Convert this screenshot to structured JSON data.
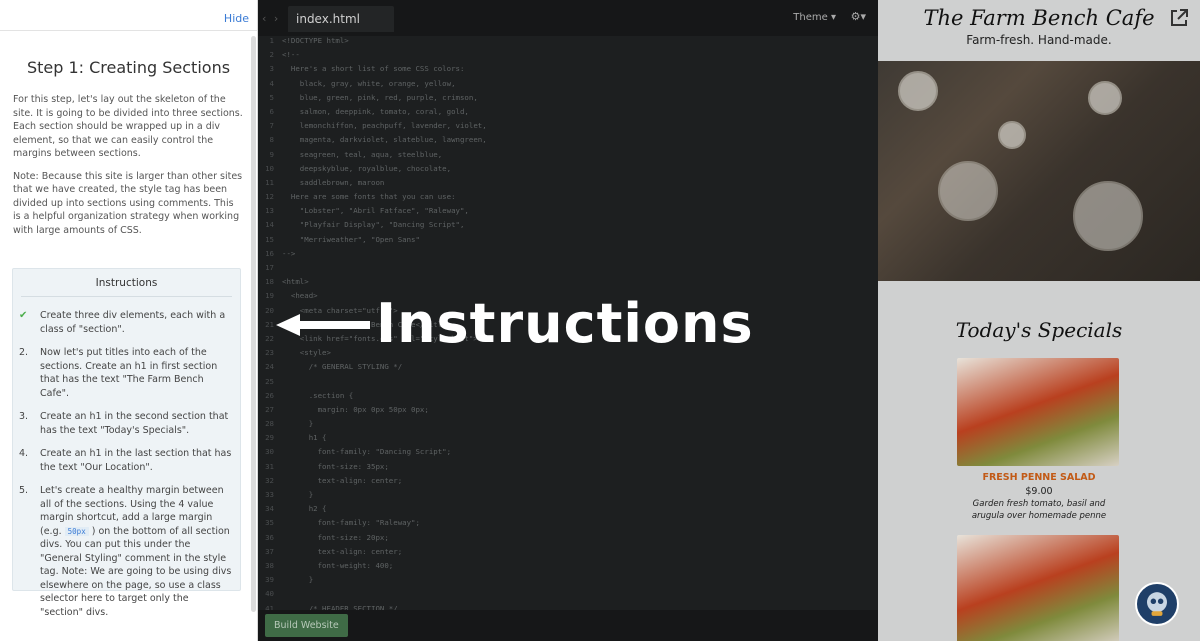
{
  "left_panel": {
    "hide_label": "Hide",
    "step_title": "Step 1: Creating Sections",
    "intro": "For this step, let's lay out the skeleton of the site. It is going to be divided into three sections. Each section should be wrapped up in a div element, so that we can easily control the margins between sections.",
    "note": "Note: Because this site is larger than other sites that we have created, the style tag has been divided up into sections using comments. This is a helpful organization strategy when working with large amounts of CSS.",
    "instructions_heading": "Instructions",
    "instructions": [
      {
        "marker": "✔",
        "text": "Create three div elements, each with a class of \"section\"."
      },
      {
        "marker": "2.",
        "text": "Now let's put titles into each of the sections. Create an h1 in first section that has the text \"The Farm Bench Cafe\"."
      },
      {
        "marker": "3.",
        "text": "Create an h1 in the second section that has the text \"Today's Specials\"."
      },
      {
        "marker": "4.",
        "text": "Create an h1 in the last section that has the text \"Our Location\"."
      },
      {
        "marker": "5.",
        "text_before": "Let's create a healthy margin between all of the sections. Using the 4 value margin shortcut, add a large margin (e.g.",
        "code": "50px",
        "text_after": ") on the bottom of all section divs. You can put this under the \"General Styling\" comment in the style tag. Note: We are going to be using divs elsewhere on the page, so use a class selector here to target only the \"section\" divs."
      }
    ]
  },
  "editor": {
    "tab_name": "index.html",
    "theme_label": "Theme ▾",
    "gear_label": "⚙▾",
    "build_button": "Build Website",
    "lines": [
      {
        "n": "1",
        "t": "<!DOCTYPE html>"
      },
      {
        "n": "2",
        "t": "<!--"
      },
      {
        "n": "3",
        "t": "  Here's a short list of some CSS colors:"
      },
      {
        "n": "4",
        "t": "    black, gray, white, orange, yellow,"
      },
      {
        "n": "5",
        "t": "    blue, green, pink, red, purple, crimson,"
      },
      {
        "n": "6",
        "t": "    salmon, deeppink, tomato, coral, gold,"
      },
      {
        "n": "7",
        "t": "    lemonchiffon, peachpuff, lavender, violet,"
      },
      {
        "n": "8",
        "t": "    magenta, darkviolet, slateblue, lawngreen,"
      },
      {
        "n": "9",
        "t": "    seagreen, teal, aqua, steelblue,"
      },
      {
        "n": "10",
        "t": "    deepskyblue, royalblue, chocolate,"
      },
      {
        "n": "11",
        "t": "    saddlebrown, maroon"
      },
      {
        "n": "12",
        "t": "  Here are some fonts that you can use:"
      },
      {
        "n": "13",
        "t": "    \"Lobster\", \"Abril Fatface\", \"Raleway\","
      },
      {
        "n": "14",
        "t": "    \"Playfair Display\", \"Dancing Script\","
      },
      {
        "n": "15",
        "t": "    \"Merriweather\", \"Open Sans\""
      },
      {
        "n": "16",
        "t": "-->"
      },
      {
        "n": "17",
        "t": ""
      },
      {
        "n": "18",
        "t": "<html>"
      },
      {
        "n": "19",
        "t": "  <head>"
      },
      {
        "n": "20",
        "t": "    <meta charset=\"utf-8\">"
      },
      {
        "n": "21",
        "t": "    <title>The Farm Bench Cafe</title>"
      },
      {
        "n": "22",
        "t": "    <link href=\"fonts.css\" rel=\"stylesheet\">"
      },
      {
        "n": "23",
        "t": "    <style>"
      },
      {
        "n": "24",
        "t": "      /* GENERAL STYLING */"
      },
      {
        "n": "25",
        "t": ""
      },
      {
        "n": "26",
        "t": "      .section {"
      },
      {
        "n": "27",
        "t": "        margin: 0px 0px 50px 0px;"
      },
      {
        "n": "28",
        "t": "      }"
      },
      {
        "n": "29",
        "t": "      h1 {"
      },
      {
        "n": "30",
        "t": "        font-family: \"Dancing Script\";"
      },
      {
        "n": "31",
        "t": "        font-size: 35px;"
      },
      {
        "n": "32",
        "t": "        text-align: center;"
      },
      {
        "n": "33",
        "t": "      }"
      },
      {
        "n": "34",
        "t": "      h2 {"
      },
      {
        "n": "35",
        "t": "        font-family: \"Raleway\";"
      },
      {
        "n": "36",
        "t": "        font-size: 20px;"
      },
      {
        "n": "37",
        "t": "        text-align: center;"
      },
      {
        "n": "38",
        "t": "        font-weight: 400;"
      },
      {
        "n": "39",
        "t": "      }"
      },
      {
        "n": "40",
        "t": ""
      },
      {
        "n": "41",
        "t": "      /* HEADER SECTION */"
      }
    ]
  },
  "overlay": {
    "label": "Instructions"
  },
  "preview": {
    "title": "The Farm Bench Cafe",
    "subtitle": "Farm-fresh. Hand-made.",
    "specials_heading": "Today's Specials",
    "dish_name": "FRESH PENNE SALAD",
    "dish_price": "$9.00",
    "dish_desc": "Garden fresh tomato, basil and arugula over homemade penne"
  },
  "colors": {
    "accent_link": "#3a7bd5",
    "check_green": "#4cae4c",
    "build_button": "#3f6b46",
    "dish_name": "#c25a16"
  }
}
